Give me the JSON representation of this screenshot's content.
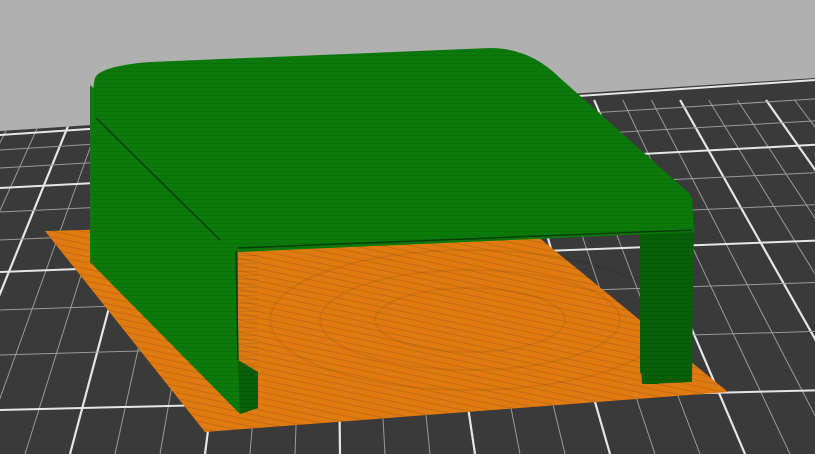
{
  "viewport": {
    "background_color": "#b0b0b0",
    "bed_color": "#3a3a3a",
    "grid_major_color": "#e6e6e6",
    "grid_minor_color": "#9a9a9a"
  },
  "model": {
    "body_color": "#0b7a0b",
    "body_shadow_color": "#075f07",
    "body_highlight_color": "#1a8f1a",
    "edge_line_color": "#0a3f0a"
  },
  "brim": {
    "color": "#e07b12",
    "shade_color": "#c7690c"
  }
}
